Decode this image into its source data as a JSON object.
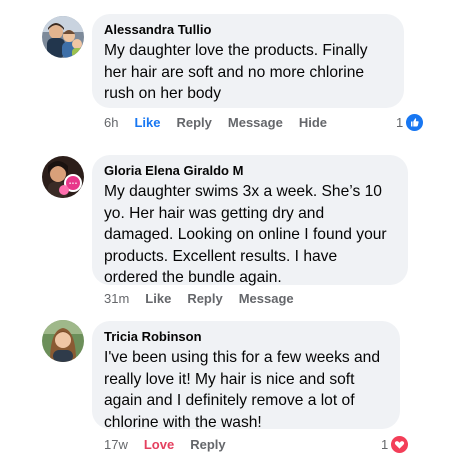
{
  "colors": {
    "bubble_bg": "#f0f2f5",
    "link_blue": "#1877f2",
    "love_red": "#e4405f",
    "meta_gray": "#65676b"
  },
  "comments": [
    {
      "author": "Alessandra Tullio",
      "text": "My daughter love the products. Finally her hair are soft and no more chlorine rush on her body",
      "time": "6h",
      "actions": [
        "Like",
        "Reply",
        "Message",
        "Hide"
      ],
      "active_action": "Like",
      "reaction_count": "1",
      "reaction_icon": "like-icon"
    },
    {
      "author": "Gloria Elena Giraldo M",
      "text": "My daughter swims 3x a week. She’s 10 yo. Her hair was getting dry and damaged. Looking on online I found your products. Excellent results. I have ordered the bundle again.",
      "time": "31m",
      "actions": [
        "Like",
        "Reply",
        "Message"
      ]
    },
    {
      "author": "Tricia Robinson",
      "text": "I've been using this for a few weeks and really love it!  My hair is nice and soft again and I definitely remove a lot of chlorine with the wash!",
      "time": "17w",
      "actions": [
        "Love",
        "Reply"
      ],
      "active_action": "Love",
      "reaction_count": "1",
      "reaction_icon": "love-icon"
    }
  ]
}
